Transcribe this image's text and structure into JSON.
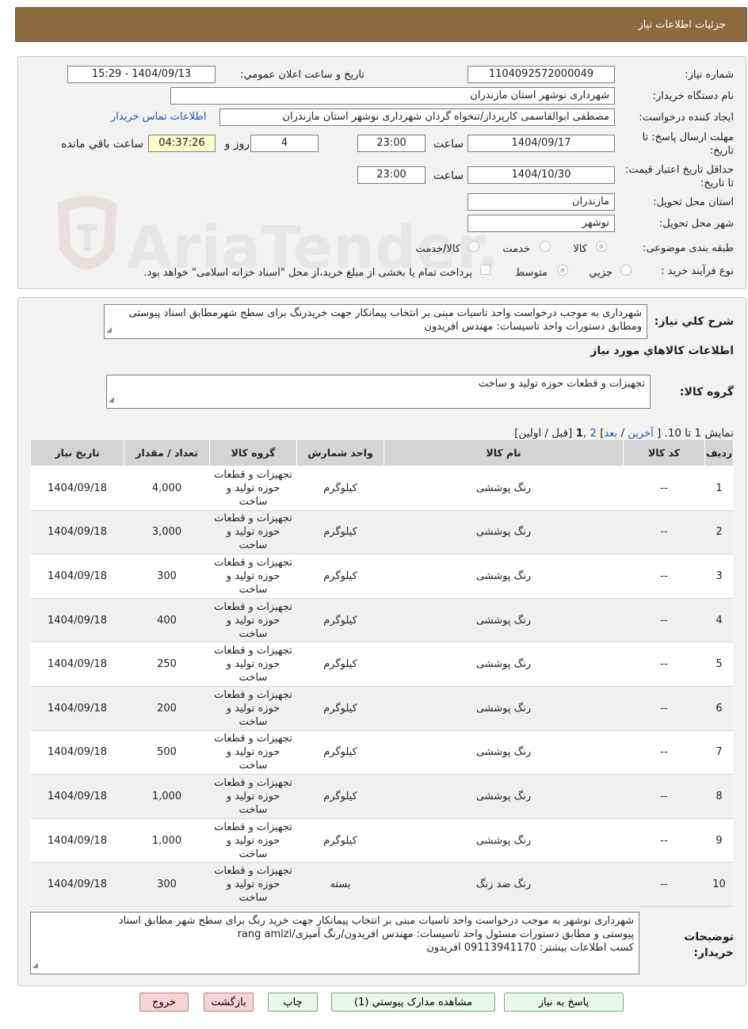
{
  "header": {
    "title": "جزئیات اطلاعات نیاز"
  },
  "form": {
    "need_number_label": "شماره نياز:",
    "need_number": "1104092572000049",
    "announce_label": "تاريخ و ساعت اعلان عمومي:",
    "announce_value": "1404/09/13 - 15:29",
    "buyer_org_label": "نام دستگاه خريدار:",
    "buyer_org": "شهرداری نوشهر استان مازندران",
    "requester_label": "ايجاد کننده درخواست:",
    "requester": "مصطفی  ابوالقاسمی کارپرداز/تنخواه گردان شهرداری نوشهر استان مازندران",
    "contact_link": "اطلاعات تماس خريدار",
    "deadline_label": "مهلت ارسال پاسخ: تا تاريخ:",
    "deadline_date": "1404/09/17",
    "time_label": "ساعت",
    "deadline_time": "23:00",
    "days_value": "4",
    "days_label": "روز و",
    "remaining_time": "04:37:26",
    "remaining_label": "ساعت باقي مانده",
    "validity_label": "حداقل تاريخ اعتبار قيمت: تا تاريخ:",
    "validity_date": "1404/10/30",
    "validity_time": "23:00",
    "province_label": "استان محل تحويل:",
    "province": "مازندران",
    "city_label": "شهر محل تحويل:",
    "city": "نوشهر",
    "category_label": "طبقه بندی موضوعی:",
    "category_options": [
      "کالا",
      "خدمت",
      "کالا/خدمت"
    ],
    "process_label": "نوع فرآيند خريد :",
    "process_options": [
      "جزيي",
      "متوسط"
    ],
    "payment_note": "پرداخت تمام يا بخشی از مبلغ خريد،از محل \"اسناد خزانه اسلامی\" خواهد بود."
  },
  "summary": {
    "label": "شرح کلي نياز:",
    "text": "شهرداری به موجب درخواست واحد تاسیات مبنی بر انتخاب پیمانکار جهت خریدرنگ برای سطح شهرمطابق اسناد پیوستی ومطابق دستورات واحد تاسیسات: مهندس افریدون",
    "items_heading": "اطلاعات کالاهاي مورد نياز",
    "group_label": "گروه کالا:",
    "group_value": "تجهيزات و قطعات حوزه توليد و ساخت",
    "pagination_prefix": "نمایش 1 تا 10. [",
    "pagination_last": "آخرين",
    "pagination_next": "بعد",
    "pagination_p2": "2",
    "pagination_p1": "1",
    "pagination_suffix": "[قبل / اولين]"
  },
  "table": {
    "headers": [
      "رديف",
      "کد کالا",
      "نام کالا",
      "واحد شمارش",
      "گروه کالا",
      "تعداد / مقدار",
      "تاريخ نياز"
    ],
    "rows": [
      {
        "idx": "1",
        "code": "--",
        "name": "رنگ پوششی",
        "unit": "کیلوگرم",
        "group": "تجهيزات و قطعات حوزه توليد و ساخت",
        "qty": "4,000",
        "date": "1404/09/18"
      },
      {
        "idx": "2",
        "code": "--",
        "name": "رنگ پوششی",
        "unit": "کیلوگرم",
        "group": "تجهيزات و قطعات حوزه توليد و ساخت",
        "qty": "3,000",
        "date": "1404/09/18"
      },
      {
        "idx": "3",
        "code": "--",
        "name": "رنگ پوششی",
        "unit": "کیلوگرم",
        "group": "تجهيزات و قطعات حوزه توليد و ساخت",
        "qty": "300",
        "date": "1404/09/18"
      },
      {
        "idx": "4",
        "code": "--",
        "name": "رنگ پوششی",
        "unit": "کیلوگرم",
        "group": "تجهيزات و قطعات حوزه توليد و ساخت",
        "qty": "400",
        "date": "1404/09/18"
      },
      {
        "idx": "5",
        "code": "--",
        "name": "رنگ پوششی",
        "unit": "کیلوگرم",
        "group": "تجهيزات و قطعات حوزه توليد و ساخت",
        "qty": "250",
        "date": "1404/09/18"
      },
      {
        "idx": "6",
        "code": "--",
        "name": "رنگ پوششی",
        "unit": "کیلوگرم",
        "group": "تجهيزات و قطعات حوزه توليد و ساخت",
        "qty": "200",
        "date": "1404/09/18"
      },
      {
        "idx": "7",
        "code": "--",
        "name": "رنگ پوششی",
        "unit": "کیلوگرم",
        "group": "تجهيزات و قطعات حوزه توليد و ساخت",
        "qty": "500",
        "date": "1404/09/18"
      },
      {
        "idx": "8",
        "code": "--",
        "name": "رنگ پوششی",
        "unit": "کیلوگرم",
        "group": "تجهيزات و قطعات حوزه توليد و ساخت",
        "qty": "1,000",
        "date": "1404/09/18"
      },
      {
        "idx": "9",
        "code": "--",
        "name": "رنگ پوششی",
        "unit": "کیلوگرم",
        "group": "تجهيزات و قطعات حوزه توليد و ساخت",
        "qty": "1,000",
        "date": "1404/09/18"
      },
      {
        "idx": "10",
        "code": "--",
        "name": "رنگ ضد زنگ",
        "unit": "بسته",
        "group": "تجهيزات و قطعات حوزه توليد و ساخت",
        "qty": "300",
        "date": "1404/09/18"
      }
    ]
  },
  "buyer_notes": {
    "label": "توضيحات خريدار:",
    "line1": "شهرداری نوشهر به موجب درخواست واحد تاسیات مبنی بر انتخاب پیمانکار جهت خرید رنگ برای سطح شهر مطابق اسناد",
    "line2": "پیوستی  و مطابق دستورات مسئول واحد تاسیسات: مهندس افریدون/رنگ آمیزی/rang amizi",
    "line3": "کسب اطلاعات بیشتر: 09113941170 افریدون"
  },
  "buttons": {
    "reply": "پاسخ به نياز",
    "attachments": "مشاهده مدارک پيوستي (1)",
    "print": "چاپ",
    "back": "بازگشت",
    "exit": "خروج"
  },
  "watermark": {
    "text": "AriaTender.neT"
  },
  "colors": {
    "header": "#8c6a40",
    "link": "#1a5aa8",
    "table_header": "#d4d4d4"
  }
}
